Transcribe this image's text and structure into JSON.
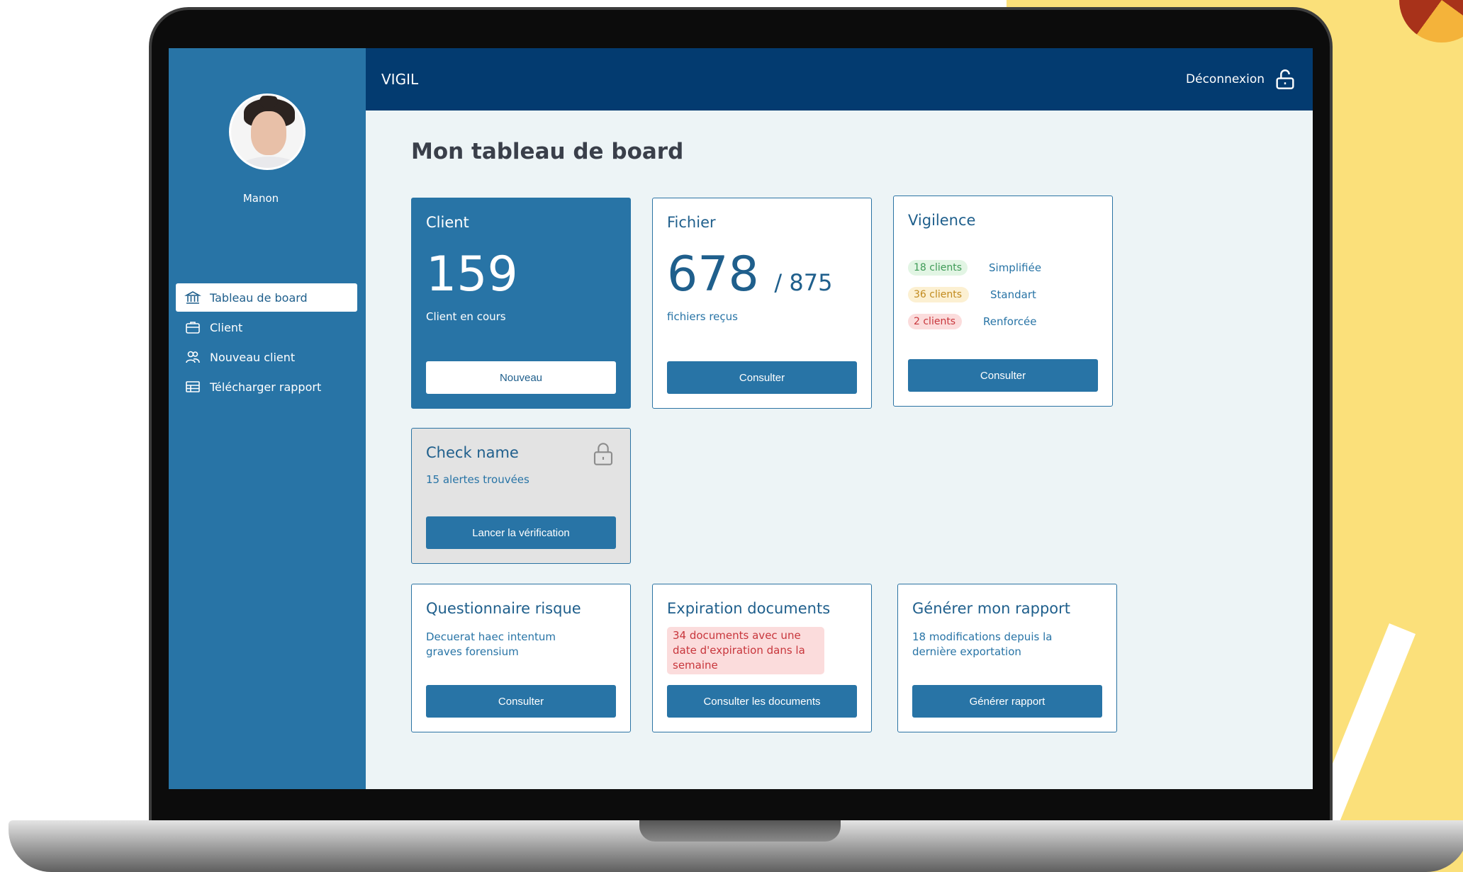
{
  "app": {
    "brand": "VIGIL",
    "logout_label": "Déconnexion"
  },
  "user": {
    "name": "Manon"
  },
  "sidebar": {
    "items": [
      {
        "label": "Tableau de board",
        "icon": "bank-icon",
        "active": true
      },
      {
        "label": "Client",
        "icon": "briefcase-icon",
        "active": false
      },
      {
        "label": "Nouveau client",
        "icon": "users-icon",
        "active": false
      },
      {
        "label": "Télécharger rapport",
        "icon": "table-icon",
        "active": false
      }
    ]
  },
  "page": {
    "title": "Mon tableau de board"
  },
  "cards": {
    "client": {
      "title": "Client",
      "count": "159",
      "subtitle": "Client en cours",
      "button": "Nouveau"
    },
    "fichier": {
      "title": "Fichier",
      "count": "678",
      "total": "/ 875",
      "subtitle": "fichiers reçus",
      "button": "Consulter"
    },
    "vigilence": {
      "title": "Vigilence",
      "rows": [
        {
          "count": "18 clients",
          "label": "Simplifiée",
          "color": "#3e9a56"
        },
        {
          "count": "36 clients",
          "label": "Standart",
          "color": "#c18a1d"
        },
        {
          "count": "2 clients",
          "label": "Renforcée",
          "color": "#c8363c"
        }
      ],
      "button": "Consulter"
    },
    "check_name": {
      "title": "Check name",
      "subtitle": "15 alertes trouvées",
      "button": "Lancer la vérification"
    },
    "questionnaire": {
      "title": "Questionnaire risque",
      "text": "Decuerat haec intentum graves forensium",
      "button": "Consulter"
    },
    "expiration": {
      "title": "Expiration documents",
      "alert": "34 documents avec une date d'expiration dans la semaine",
      "button": "Consulter les documents"
    },
    "rapport": {
      "title": "Générer mon rapport",
      "text": "18 modifications depuis la dernière exportation",
      "button": "Générer rapport"
    }
  },
  "colors": {
    "sidebar": "#2874a6",
    "topbar": "#033b70",
    "accent": "#2874a6",
    "background": "#edf4f6"
  }
}
